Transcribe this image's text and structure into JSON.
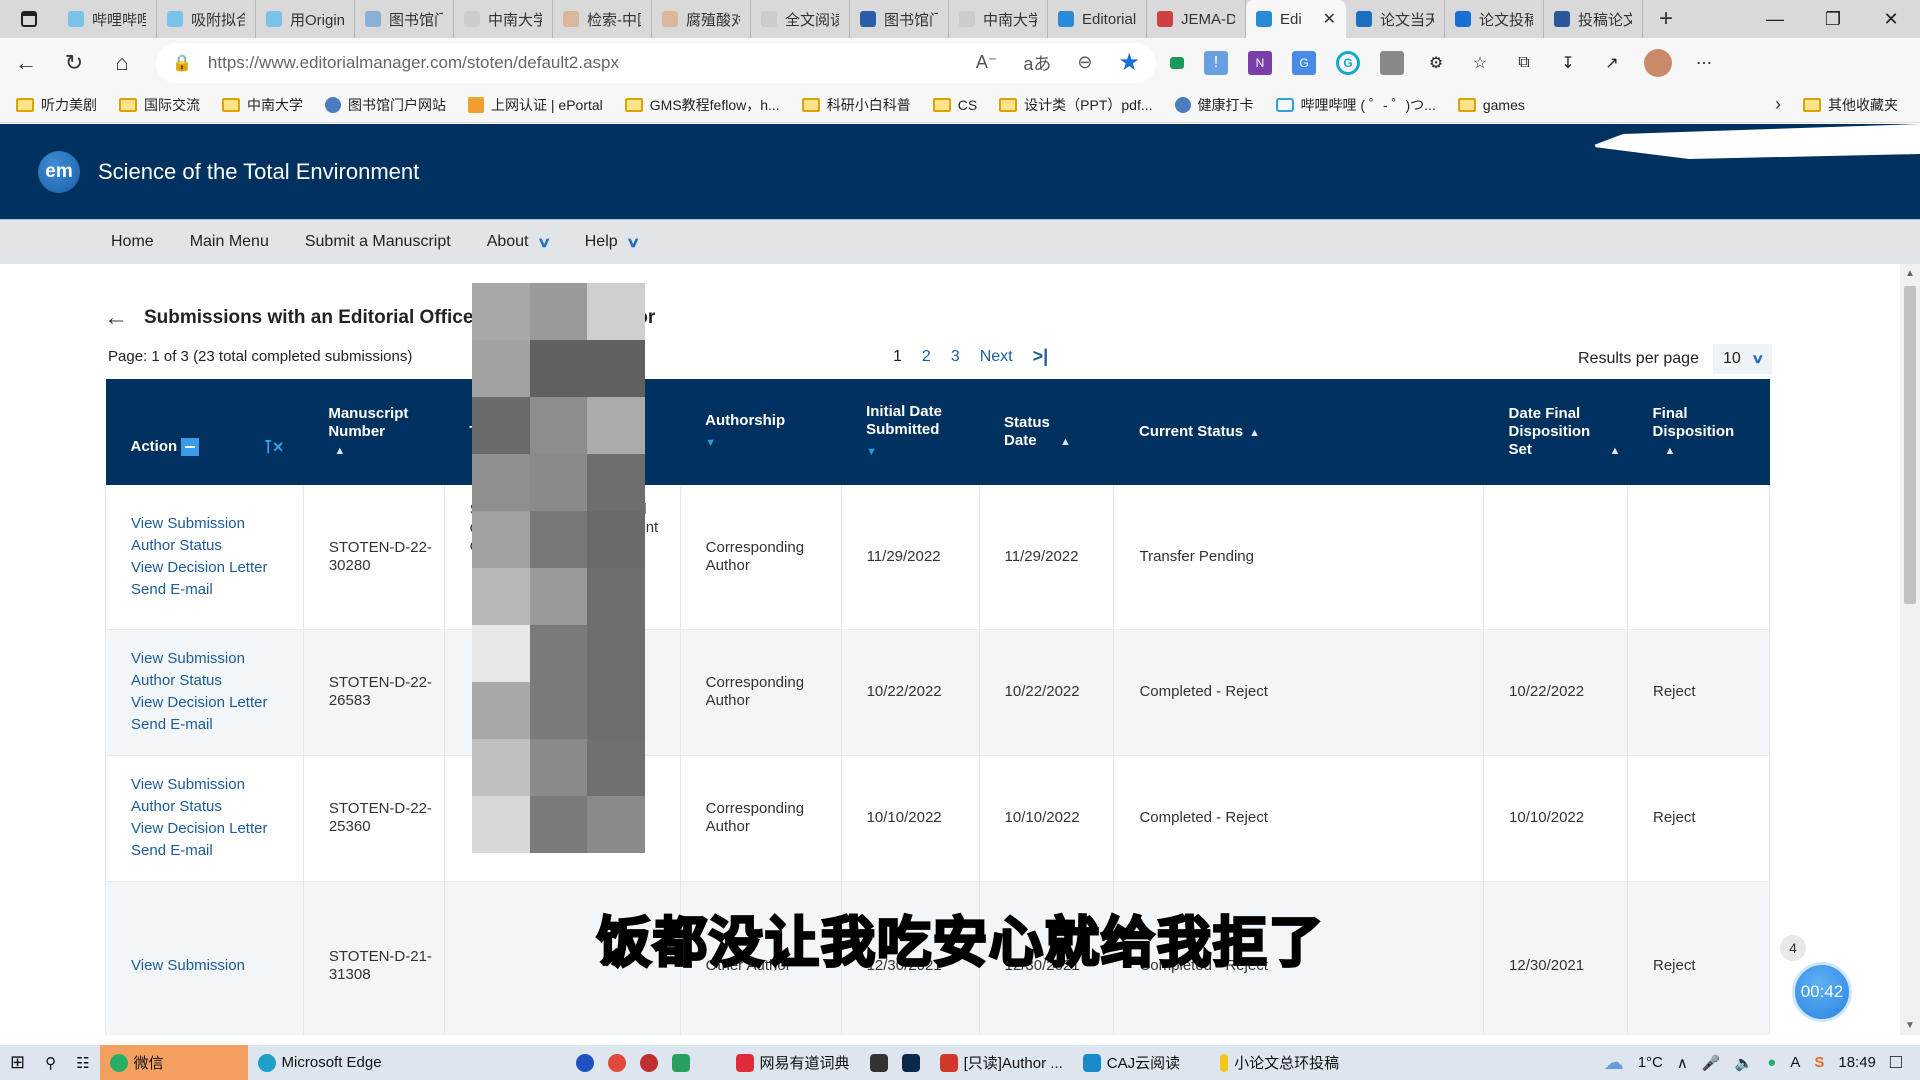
{
  "browser": {
    "tabs": [
      {
        "label": "哔哩哔哩",
        "icon": "bilibili-icon",
        "color": "#7ac3e8"
      },
      {
        "label": "吸附拟合",
        "icon": "bilibili-icon",
        "color": "#7ac3e8"
      },
      {
        "label": "用Origin",
        "icon": "bilibili-icon",
        "color": "#7ac3e8"
      },
      {
        "label": "图书馆门",
        "icon": "library-icon",
        "color": "#8ab0d8"
      },
      {
        "label": "中南大学",
        "icon": "page-icon",
        "color": "#cccccc"
      },
      {
        "label": "检索-中国",
        "icon": "zhihu-icon",
        "color": "#d8b898"
      },
      {
        "label": "腐殖酸对",
        "icon": "zhihu-icon",
        "color": "#d8b898"
      },
      {
        "label": "全文阅读",
        "icon": "doc-icon",
        "color": "#cccccc"
      },
      {
        "label": "图书馆门",
        "icon": "library-icon",
        "color": "#2a5ea8"
      },
      {
        "label": "中南大学",
        "icon": "page-icon",
        "color": "#cccccc"
      },
      {
        "label": "Editorial",
        "icon": "editorial-manager-icon",
        "color": "#2a8bd8"
      },
      {
        "label": "JEMA-D",
        "icon": "pdf-icon",
        "color": "#d04040"
      },
      {
        "label": "Edi",
        "icon": "editorial-manager-icon",
        "color": "#2a8bd8",
        "active": true
      },
      {
        "label": "论文当天",
        "icon": "search-icon",
        "color": "#1d6fc2"
      },
      {
        "label": "论文投稿",
        "icon": "zhihu-icon",
        "color": "#1a6fd4"
      },
      {
        "label": "投稿论文",
        "icon": "word-icon",
        "color": "#2b579a"
      }
    ],
    "new_tab": "+",
    "url_host": "https://www.editorialmanager.com",
    "url_path": "/stoten/default2.aspx",
    "bookmarks": [
      {
        "label": "听力美剧",
        "icon": "folder-icon"
      },
      {
        "label": "国际交流",
        "icon": "folder-icon"
      },
      {
        "label": "中南大学",
        "icon": "folder-icon"
      },
      {
        "label": "图书馆门户网站",
        "icon": "library-icon"
      },
      {
        "label": "上网认证 | ePortal",
        "icon": "eportal-icon"
      },
      {
        "label": "GMS教程feflow，h...",
        "icon": "folder-icon"
      },
      {
        "label": "科研小白科普",
        "icon": "folder-icon"
      },
      {
        "label": "CS",
        "icon": "folder-icon"
      },
      {
        "label": "设计类（PPT）pdf...",
        "icon": "folder-icon"
      },
      {
        "label": "健康打卡",
        "icon": "library-icon"
      },
      {
        "label": "哔哩哔哩 ( ゜- ゜)つ...",
        "icon": "bilibili-icon"
      },
      {
        "label": "games",
        "icon": "folder-icon"
      }
    ],
    "other_bookmarks": "其他收藏夹"
  },
  "site": {
    "logo_text": "em",
    "title": "Science of the Total Environment",
    "nav": [
      "Home",
      "Main Menu",
      "Submit a Manuscript",
      "About",
      "Help"
    ],
    "accent": "#00315f"
  },
  "page": {
    "title": "Submissions with an Editorial Office Decision for Author",
    "page_info": "Page: 1 of 3 (23 total completed submissions)",
    "pager": {
      "current": "1",
      "pages": [
        "2",
        "3"
      ],
      "next": "Next",
      "last": ">|"
    },
    "results_per_page_label": "Results per page",
    "results_per_page_value": "10"
  },
  "table": {
    "headers": {
      "action": "Action",
      "manuscript_number": "Manuscript Number",
      "title": "Title",
      "authorship": "Authorship",
      "initial_date": "Initial Date Submitted",
      "status_date": "Status Date",
      "current_status": "Current Status",
      "date_final": "Date Final Disposition Set",
      "final_disposition": "Final Disposition"
    },
    "rows": [
      {
        "actions": [
          "View Submission",
          "Author Status",
          "View Decision Letter",
          "Send E-mail"
        ],
        "manuscript_number": "STOTEN-D-22-30280",
        "title": "Source apportionment and quantitative risk assessment of heavy...",
        "authorship": "Corresponding Author",
        "initial_date": "11/29/2022",
        "status_date": "11/29/2022",
        "current_status": "Transfer Pending",
        "date_final": "",
        "final_disposition": ""
      },
      {
        "actions": [
          "View Submission",
          "Author Status",
          "View Decision Letter",
          "Send E-mail"
        ],
        "manuscript_number": "STOTEN-D-22-26583",
        "title": "",
        "authorship": "Corresponding Author",
        "initial_date": "10/22/2022",
        "status_date": "10/22/2022",
        "current_status": "Completed - Reject",
        "date_final": "10/22/2022",
        "final_disposition": "Reject"
      },
      {
        "actions": [
          "View Submission",
          "Author Status",
          "View Decision Letter",
          "Send E-mail"
        ],
        "manuscript_number": "STOTEN-D-22-25360",
        "title": "",
        "authorship": "Corresponding Author",
        "initial_date": "10/10/2022",
        "status_date": "10/10/2022",
        "current_status": "Completed - Reject",
        "date_final": "10/10/2022",
        "final_disposition": "Reject"
      },
      {
        "actions": [
          "View Submission"
        ],
        "manuscript_number": "STOTEN-D-21-31308",
        "title": "",
        "authorship": "Other Author",
        "initial_date": "12/30/2021",
        "status_date": "12/30/2021",
        "current_status": "Completed - Reject",
        "date_final": "12/30/2021",
        "final_disposition": "Reject"
      }
    ]
  },
  "overlay": {
    "subtitle": "饭都没让我吃安心就给我拒了",
    "timer": "00:42",
    "badge": "4"
  },
  "taskbar": {
    "apps": [
      "微信",
      "Microsoft Edge",
      "网易有道词典",
      "[只读]Author ...",
      "CAJ云阅读",
      "小论文总环投稿"
    ],
    "weather": "1°C",
    "time": "18:49"
  }
}
